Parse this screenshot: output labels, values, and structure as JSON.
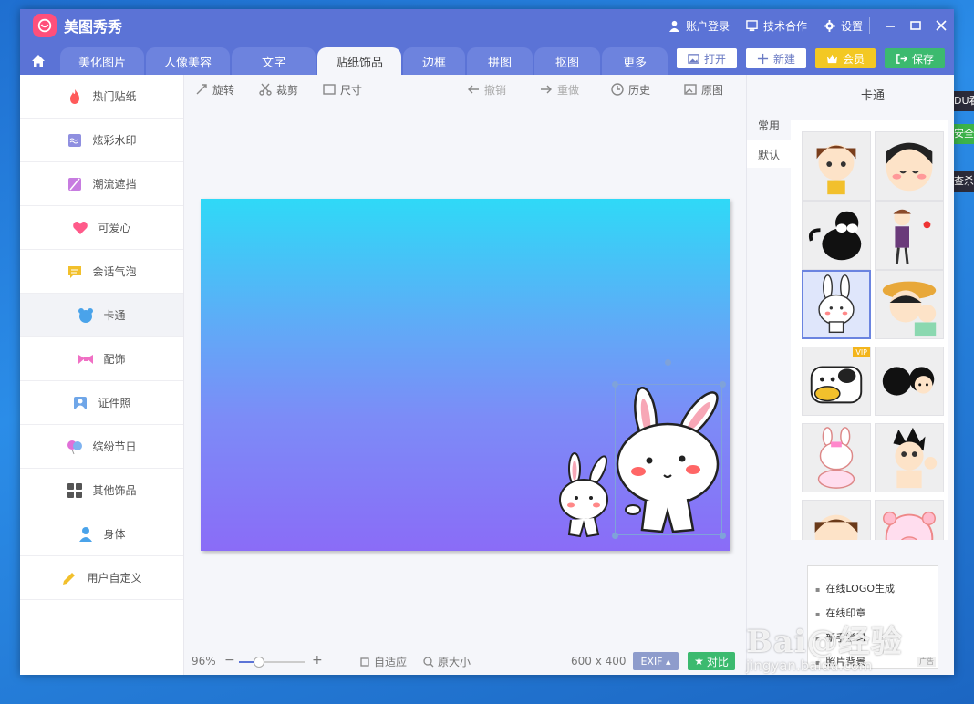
{
  "desktop": {
    "edge_items": [
      "DU看",
      "安全",
      "查杀"
    ]
  },
  "titlebar": {
    "app_name": "美图秀秀",
    "account_login": "账户登录",
    "tech_coop": "技术合作",
    "settings": "设置"
  },
  "tabs": [
    {
      "label": "美化图片"
    },
    {
      "label": "人像美容"
    },
    {
      "label": "文字"
    },
    {
      "label": "贴纸饰品",
      "active": true
    },
    {
      "label": "边框"
    },
    {
      "label": "拼图"
    },
    {
      "label": "抠图"
    },
    {
      "label": "更多"
    }
  ],
  "tab_buttons": {
    "open": "打开",
    "new": "新建",
    "vip": "会员",
    "save": "保存"
  },
  "sidebar": {
    "items": [
      {
        "label": "热门贴纸",
        "icon": "flame-icon",
        "color": "#ff5a5a"
      },
      {
        "label": "炫彩水印",
        "icon": "watermark-icon",
        "color": "#8f8fe0"
      },
      {
        "label": "潮流遮挡",
        "icon": "slash-block-icon",
        "color": "#c77ce0"
      },
      {
        "label": "可爱心",
        "icon": "heart-icon",
        "color": "#ff5a8a"
      },
      {
        "label": "会话气泡",
        "icon": "speech-bubble-icon",
        "color": "#f2c02c"
      },
      {
        "label": "卡通",
        "icon": "bear-face-icon",
        "color": "#4aa3ea",
        "active": true
      },
      {
        "label": "配饰",
        "icon": "bow-icon",
        "color": "#f06fc4"
      },
      {
        "label": "证件照",
        "icon": "id-photo-icon",
        "color": "#6fa6e8"
      },
      {
        "label": "缤纷节日",
        "icon": "balloons-icon",
        "color": "#e070d8"
      },
      {
        "label": "其他饰品",
        "icon": "grid-icon",
        "color": "#555555"
      },
      {
        "label": "身体",
        "icon": "person-icon",
        "color": "#4aa3ea"
      },
      {
        "label": "用户自定义",
        "icon": "pencil-icon",
        "color": "#f2c02c"
      }
    ]
  },
  "toolbar": {
    "rotate": "旋转",
    "crop": "裁剪",
    "size": "尺寸",
    "undo": "撤销",
    "redo": "重做",
    "history": "历史",
    "original": "原图"
  },
  "status": {
    "zoom": "96%",
    "zoom_level": 0.3,
    "fit": "自适应",
    "actual_size": "原大小",
    "canvas_size": "600 x 400",
    "exif": "EXIF",
    "compare": "对比"
  },
  "right_panel": {
    "title": "卡通",
    "sub_tabs": [
      "常用",
      "默认"
    ],
    "active_sub_tab": 1,
    "stickers": [
      "girl-crying-sticker",
      "chibi-maruko-sticker",
      "black-cat-sticker",
      "boy-flower-sticker",
      "bunny-sticker",
      "maruko-hat-sticker",
      "cow-sticker",
      "black-hair-couple-sticker",
      "nurse-bunny-sticker",
      "astro-boy-sticker",
      "girl-face-sticker",
      "pink-pig-sticker"
    ],
    "selected_sticker": 4,
    "vip_sticker": 6,
    "vip_label": "VIP",
    "promo": [
      "在线LOGO生成",
      "在线印章",
      "新手学习",
      "照片背景"
    ],
    "ad_label": "广告"
  },
  "watermark": {
    "main": "Bai@经验",
    "sub": "jingyan.baidu.com"
  },
  "colors": {
    "titlebar": "#5b73d6",
    "canvas_top": "#2fd9f7",
    "canvas_bottom": "#8a6cf7",
    "save_green": "#3cba6f",
    "vip_yellow": "#f3c823"
  }
}
